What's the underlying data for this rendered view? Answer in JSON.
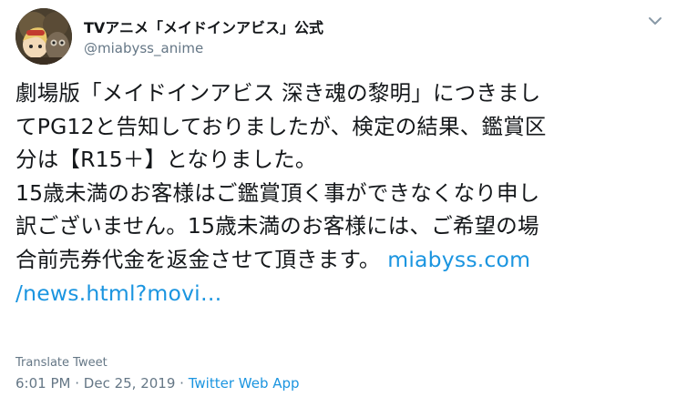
{
  "tweet": {
    "display_name": "TVアニメ「メイドインアビス」公式",
    "handle": "@miabyss_anime",
    "body_lines": [
      "劇場版「メイドインアビス 深き魂の黎明」につきまし",
      "てPG12と告知しておりましたが、検定の結果、鑑賞区",
      "分は【R15＋】となりました。",
      "15歳未満のお客様はご鑑賞頂く事ができなくなり申し",
      "訳ございません。15歳未満のお客様には、ご希望の場",
      "合前売券代金を返金させて頂きます。 "
    ],
    "link_part1": "miabyss.com",
    "link_part2": "/news.html?movi…",
    "translate_label": "Translate Tweet",
    "time": "6:01 PM",
    "separator": "·",
    "date": "Dec 25, 2019",
    "source": "Twitter Web App"
  },
  "colors": {
    "link": "#1b95e0",
    "secondary": "#657786",
    "text": "#14171a"
  },
  "icons": {
    "menu": "chevron-down-icon",
    "avatar": "avatar"
  }
}
